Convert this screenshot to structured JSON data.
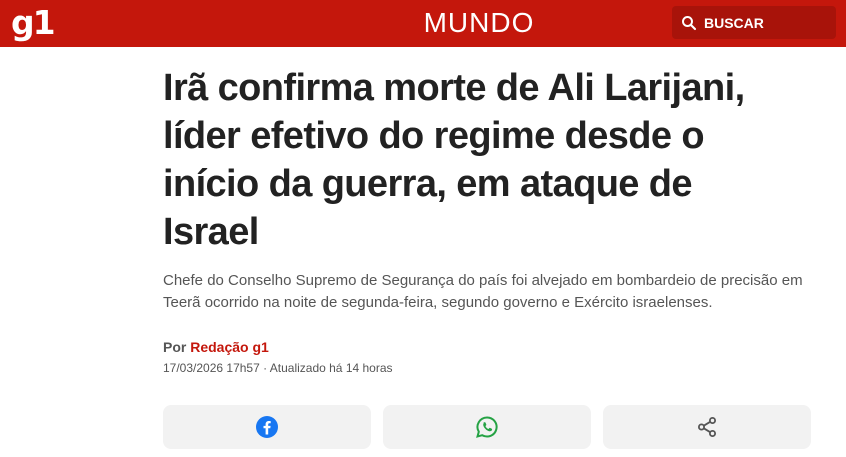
{
  "header": {
    "logo": "g1",
    "section": "MUNDO",
    "search_label": "BUSCAR",
    "brand_color": "#c4170c"
  },
  "article": {
    "headline": "Irã confirma morte de Ali Larijani, líder efetivo do regime desde o início da guerra, em ataque de Israel",
    "subtitle": "Chefe do Conselho Supremo de Segurança do país foi alvejado em bombardeio de precisão em Teerã ocorrido na noite de segunda-feira, segundo governo e Exército israelenses.",
    "byline_prefix": "Por",
    "author": "Redação g1",
    "dateline": "17/03/2026 17h57 · Atualizado há 14 horas"
  },
  "share": {
    "buttons": [
      {
        "icon": "facebook-icon",
        "color": "#1877f2"
      },
      {
        "icon": "whatsapp-icon",
        "color": "#25a244"
      },
      {
        "icon": "share-icon",
        "color": "#555555"
      }
    ]
  }
}
